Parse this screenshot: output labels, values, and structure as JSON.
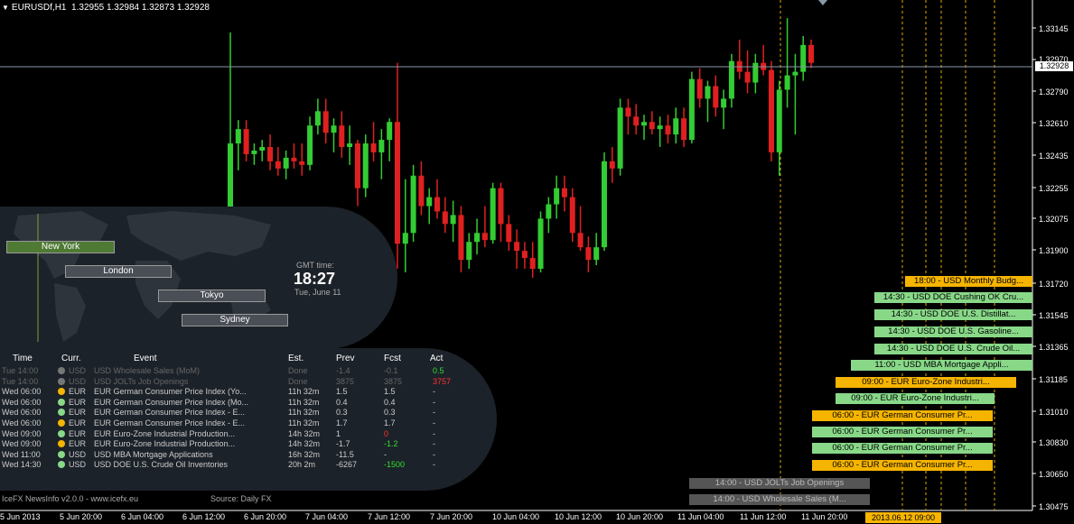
{
  "header": {
    "symbol_line": "EURUSDf,H1  1.32955 1.32984 1.32873 1.32928"
  },
  "price_axis": {
    "labels": [
      "1.33145",
      "1.32970",
      "1.32790",
      "1.32610",
      "1.32435",
      "1.32255",
      "1.32075",
      "1.31900",
      "1.31720",
      "1.31545",
      "1.31365",
      "1.31185",
      "1.31010",
      "1.30830",
      "1.30650",
      "1.30475"
    ],
    "current_price": "1.32928"
  },
  "time_axis": {
    "labels": [
      "5 Jun 2013",
      "5 Jun 20:00",
      "6 Jun 04:00",
      "6 Jun 12:00",
      "6 Jun 20:00",
      "7 Jun 04:00",
      "7 Jun 12:00",
      "7 Jun 20:00",
      "10 Jun 04:00",
      "10 Jun 12:00",
      "10 Jun 20:00",
      "11 Jun 04:00",
      "11 Jun 12:00",
      "11 Jun 20:00"
    ],
    "cursor_label": "2013.06.12 09:00"
  },
  "colors": {
    "bull": "#33cc33",
    "bear": "#e02020",
    "event_green": "#88d888",
    "event_orange": "#f5b400",
    "event_gray": "#555555"
  },
  "chart_data": {
    "type": "candlestick",
    "symbol": "EURUSDf",
    "timeframe": "H1",
    "ylim": [
      1.304,
      1.3325
    ],
    "ohlc": [
      [
        1.3183,
        1.3312,
        1.318,
        1.325
      ],
      [
        1.325,
        1.3263,
        1.3235,
        1.3258
      ],
      [
        1.3258,
        1.3263,
        1.324,
        1.3244
      ],
      [
        1.3244,
        1.325,
        1.3238,
        1.3246
      ],
      [
        1.3246,
        1.3252,
        1.324,
        1.3248
      ],
      [
        1.3248,
        1.3255,
        1.3235,
        1.324
      ],
      [
        1.324,
        1.3248,
        1.3232,
        1.3236
      ],
      [
        1.3236,
        1.3246,
        1.323,
        1.3242
      ],
      [
        1.3242,
        1.325,
        1.3236,
        1.324
      ],
      [
        1.324,
        1.325,
        1.3232,
        1.3238
      ],
      [
        1.3238,
        1.3265,
        1.3235,
        1.326
      ],
      [
        1.326,
        1.3275,
        1.3255,
        1.3268
      ],
      [
        1.3268,
        1.3275,
        1.325,
        1.3256
      ],
      [
        1.3256,
        1.3264,
        1.3245,
        1.326
      ],
      [
        1.326,
        1.3268,
        1.3242,
        1.3248
      ],
      [
        1.3248,
        1.326,
        1.3238,
        1.325
      ],
      [
        1.325,
        1.3252,
        1.3215,
        1.3225
      ],
      [
        1.3225,
        1.3255,
        1.322,
        1.325
      ],
      [
        1.325,
        1.3262,
        1.324,
        1.3245
      ],
      [
        1.3245,
        1.3258,
        1.323,
        1.3252
      ],
      [
        1.3252,
        1.3264,
        1.324,
        1.3262
      ],
      [
        1.3262,
        1.3295,
        1.318,
        1.3194
      ],
      [
        1.3194,
        1.323,
        1.3178,
        1.32
      ],
      [
        1.32,
        1.3238,
        1.3195,
        1.3232
      ],
      [
        1.3232,
        1.324,
        1.321,
        1.3215
      ],
      [
        1.3215,
        1.3225,
        1.3205,
        1.322
      ],
      [
        1.322,
        1.323,
        1.3208,
        1.3212
      ],
      [
        1.3212,
        1.322,
        1.32,
        1.3205
      ],
      [
        1.3205,
        1.3218,
        1.3195,
        1.321
      ],
      [
        1.321,
        1.3215,
        1.3178,
        1.3185
      ],
      [
        1.3185,
        1.32,
        1.318,
        1.3195
      ],
      [
        1.3195,
        1.3208,
        1.3188,
        1.32
      ],
      [
        1.32,
        1.3215,
        1.3192,
        1.3196
      ],
      [
        1.3196,
        1.3228,
        1.3194,
        1.3225
      ],
      [
        1.3225,
        1.3228,
        1.3195,
        1.3205
      ],
      [
        1.3205,
        1.321,
        1.319,
        1.3195
      ],
      [
        1.3195,
        1.3202,
        1.318,
        1.319
      ],
      [
        1.319,
        1.3195,
        1.318,
        1.3186
      ],
      [
        1.3186,
        1.3195,
        1.3175,
        1.318
      ],
      [
        1.318,
        1.3212,
        1.3178,
        1.3208
      ],
      [
        1.3208,
        1.322,
        1.32,
        1.3216
      ],
      [
        1.3216,
        1.3232,
        1.3208,
        1.3225
      ],
      [
        1.3225,
        1.3232,
        1.3212,
        1.322
      ],
      [
        1.322,
        1.3225,
        1.3195,
        1.32
      ],
      [
        1.32,
        1.3215,
        1.319,
        1.3192
      ],
      [
        1.3192,
        1.3198,
        1.3178,
        1.3185
      ],
      [
        1.3185,
        1.32,
        1.3182,
        1.3192
      ],
      [
        1.3192,
        1.3245,
        1.319,
        1.324
      ],
      [
        1.324,
        1.3248,
        1.3228,
        1.3236
      ],
      [
        1.3236,
        1.3275,
        1.3232,
        1.327
      ],
      [
        1.327,
        1.3275,
        1.3255,
        1.3265
      ],
      [
        1.3265,
        1.3272,
        1.3255,
        1.326
      ],
      [
        1.326,
        1.3266,
        1.3252,
        1.3262
      ],
      [
        1.3262,
        1.3268,
        1.3255,
        1.3258
      ],
      [
        1.3258,
        1.3265,
        1.3248,
        1.326
      ],
      [
        1.326,
        1.3266,
        1.325,
        1.3255
      ],
      [
        1.3255,
        1.327,
        1.325,
        1.3264
      ],
      [
        1.3264,
        1.327,
        1.3248,
        1.3252
      ],
      [
        1.3252,
        1.329,
        1.325,
        1.3286
      ],
      [
        1.3286,
        1.3292,
        1.327,
        1.3275
      ],
      [
        1.3275,
        1.3285,
        1.3262,
        1.3282
      ],
      [
        1.3282,
        1.3288,
        1.3265,
        1.327
      ],
      [
        1.327,
        1.328,
        1.3258,
        1.3275
      ],
      [
        1.3275,
        1.33,
        1.327,
        1.3296
      ],
      [
        1.3296,
        1.3308,
        1.3286,
        1.329
      ],
      [
        1.329,
        1.3302,
        1.3278,
        1.3284
      ],
      [
        1.3284,
        1.33,
        1.3278,
        1.3295
      ],
      [
        1.3295,
        1.3305,
        1.3288,
        1.3291
      ],
      [
        1.3291,
        1.3296,
        1.324,
        1.3245
      ],
      [
        1.3245,
        1.3285,
        1.3232,
        1.328
      ],
      [
        1.328,
        1.332,
        1.327,
        1.3288
      ],
      [
        1.3288,
        1.33,
        1.3255,
        1.329
      ],
      [
        1.329,
        1.331,
        1.3285,
        1.3305
      ],
      [
        1.3305,
        1.3308,
        1.3292,
        1.3295
      ]
    ]
  },
  "world_clock": {
    "sessions": [
      {
        "name": "New York",
        "color": "#4e7a34"
      },
      {
        "name": "London",
        "color": "#4a4e56"
      },
      {
        "name": "Tokyo",
        "color": "#4a4e56"
      },
      {
        "name": "Sydney",
        "color": "#4a4e56"
      }
    ],
    "gmt_label": "GMT time:",
    "gmt_time": "18:27",
    "gmt_date": "Tue, June 11"
  },
  "news": {
    "headers": [
      "Time",
      "Curr.",
      "Event",
      "Est.",
      "Prev",
      "Fcst",
      "Act"
    ],
    "rows": [
      {
        "time": "Tue  14:00",
        "dot": "#777777",
        "curr": "USD",
        "event": "USD Wholesale Sales (MoM)",
        "est": "Done",
        "prev": "-1.4",
        "fcst": "-0.1",
        "act": "0.5",
        "text_color": "#666666",
        "act_color": "#33dd33"
      },
      {
        "time": "Tue  14:00",
        "dot": "#777777",
        "curr": "USD",
        "event": "USD JOLTs Job Openings",
        "est": "Done",
        "prev": "3875",
        "fcst": "3875",
        "act": "3757",
        "text_color": "#666666",
        "act_color": "#ff3333"
      },
      {
        "time": "Wed 06:00",
        "dot": "#f5b400",
        "curr": "EUR",
        "event": "EUR German Consumer Price Index (Yo...",
        "est": "11h 32m",
        "prev": "1.5",
        "fcst": "1.5",
        "act": "-",
        "text_color": "#cccccc",
        "act_color": "#cccccc"
      },
      {
        "time": "Wed 06:00",
        "dot": "#88d888",
        "curr": "EUR",
        "event": "EUR German Consumer Price Index (Mo...",
        "est": "11h 32m",
        "prev": "0.4",
        "fcst": "0.4",
        "act": "-",
        "text_color": "#cccccc",
        "act_color": "#cccccc"
      },
      {
        "time": "Wed 06:00",
        "dot": "#88d888",
        "curr": "EUR",
        "event": "EUR German Consumer Price Index - E...",
        "est": "11h 32m",
        "prev": "0.3",
        "fcst": "0.3",
        "act": "-",
        "text_color": "#cccccc",
        "act_color": "#cccccc"
      },
      {
        "time": "Wed 06:00",
        "dot": "#f5b400",
        "curr": "EUR",
        "event": "EUR German Consumer Price Index - E...",
        "est": "11h 32m",
        "prev": "1.7",
        "fcst": "1.7",
        "act": "-",
        "text_color": "#cccccc",
        "act_color": "#cccccc"
      },
      {
        "time": "Wed 09:00",
        "dot": "#88d888",
        "curr": "EUR",
        "event": "EUR Euro-Zone Industrial Production...",
        "est": "14h 32m",
        "prev": "1",
        "fcst": "0",
        "act": "-",
        "text_color": "#cccccc",
        "act_color": "#cccccc",
        "fcst_color": "#ff3333"
      },
      {
        "time": "Wed 09:00",
        "dot": "#f5b400",
        "curr": "EUR",
        "event": "EUR Euro-Zone Industrial Production...",
        "est": "14h 32m",
        "prev": "-1.7",
        "fcst": "-1.2",
        "act": "-",
        "text_color": "#cccccc",
        "act_color": "#cccccc",
        "fcst_color": "#33dd33"
      },
      {
        "time": "Wed 11:00",
        "dot": "#88d888",
        "curr": "USD",
        "event": "USD MBA Mortgage Applications",
        "est": "16h 32m",
        "prev": "-11.5",
        "fcst": "-",
        "act": "-",
        "text_color": "#cccccc",
        "act_color": "#cccccc"
      },
      {
        "time": "Wed 14:30",
        "dot": "#88d888",
        "curr": "USD",
        "event": "USD DOE U.S. Crude Oil Inventories",
        "est": "20h 2m",
        "prev": "-6267",
        "fcst": "-1500",
        "act": "-",
        "text_color": "#cccccc",
        "act_color": "#cccccc",
        "fcst_color": "#33dd33"
      }
    ],
    "footer_left": "IceFX NewsInfo v2.0.0  -  www.icefx.eu",
    "footer_right": "Source: Daily FX"
  },
  "events": [
    {
      "label": "18:00 - USD Monthly Budg...",
      "color": "#f5b400"
    },
    {
      "label": "14:30 - USD DOE Cushing OK Cru...",
      "color": "#88d888"
    },
    {
      "label": "14:30 - USD DOE U.S. Distillat...",
      "color": "#88d888"
    },
    {
      "label": "14:30 - USD DOE U.S. Gasoline...",
      "color": "#88d888"
    },
    {
      "label": "14:30 - USD DOE U.S. Crude Oil...",
      "color": "#88d888"
    },
    {
      "label": "11:00 - USD MBA Mortgage Appli...",
      "color": "#88d888"
    },
    {
      "label": "09:00 - EUR Euro-Zone Industri...",
      "color": "#f5b400"
    },
    {
      "label": "09:00 - EUR Euro-Zone Industri...",
      "color": "#88d888"
    },
    {
      "label": "06:00 - EUR German Consumer Pr...",
      "color": "#f5b400"
    },
    {
      "label": "06:00 - EUR German Consumer Pr...",
      "color": "#88d888"
    },
    {
      "label": "06:00 - EUR German Consumer Pr...",
      "color": "#88d888"
    },
    {
      "label": "06:00 - EUR German Consumer Pr...",
      "color": "#f5b400"
    },
    {
      "label": "14:00 - USD JOLTs Job Openings",
      "color": "#555555"
    },
    {
      "label": "14:00 - USD Wholesale Sales (M...",
      "color": "#555555"
    }
  ]
}
